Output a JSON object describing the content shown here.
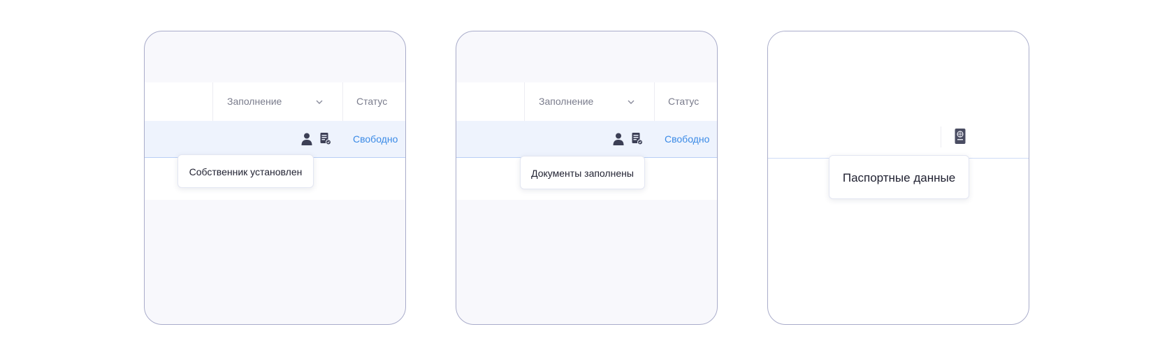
{
  "accent_color": "#3a8ae6",
  "panels": [
    {
      "header": {
        "fill_label": "Заполнение",
        "status_label": "Статус"
      },
      "row": {
        "status": "Свободно",
        "icons": [
          "person-icon",
          "document-certificate-icon"
        ]
      },
      "tooltip": "Собственник установлен"
    },
    {
      "header": {
        "fill_label": "Заполнение",
        "status_label": "Статус"
      },
      "row": {
        "status": "Свободно",
        "icons": [
          "person-icon",
          "document-certificate-icon"
        ]
      },
      "tooltip": "Документы заполнены"
    },
    {
      "row": {
        "icons": [
          "passport-icon"
        ]
      },
      "tooltip": "Паспортные данные"
    }
  ]
}
